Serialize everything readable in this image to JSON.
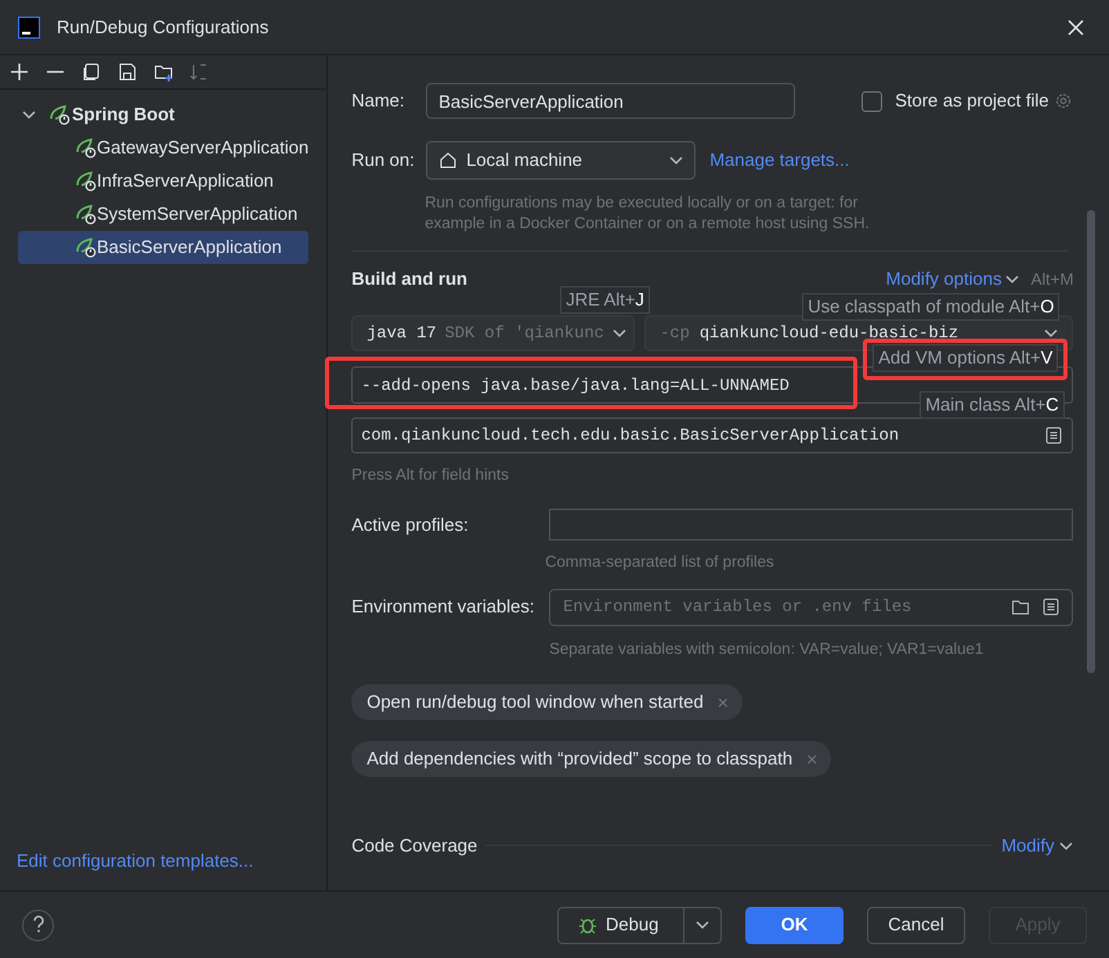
{
  "window": {
    "title": "Run/Debug Configurations"
  },
  "tree": {
    "label": "Spring Boot",
    "expanded": true,
    "children": [
      {
        "label": "GatewayServerApplication",
        "selected": false
      },
      {
        "label": "InfraServerApplication",
        "selected": false
      },
      {
        "label": "SystemServerApplication",
        "selected": false
      },
      {
        "label": "BasicServerApplication",
        "selected": true
      }
    ]
  },
  "templates_link": "Edit configuration templates...",
  "name": {
    "label": "Name:",
    "value": "BasicServerApplication"
  },
  "store_checkbox": {
    "label": "Store as project file",
    "checked": false
  },
  "run_on": {
    "label": "Run on:",
    "value": "Local machine",
    "link": "Manage targets...",
    "hint": "Run configurations may be executed locally or on a target: for example in a Docker Container or on a remote host using SSH."
  },
  "build_and_run": {
    "title": "Build and run",
    "modify_link": "Modify options",
    "modify_shortcut": "Alt+M",
    "jre": {
      "version": "java 17",
      "detail": "SDK of 'qiankunc"
    },
    "classpath": {
      "prefix": "-cp",
      "module": "qiankuncloud-edu-basic-biz"
    },
    "vm_options": "--add-opens java.base/java.lang=ALL-UNNAMED",
    "main_class": "com.qiankuncloud.tech.edu.basic.BasicServerApplication",
    "field_hint": "Press Alt for field hints"
  },
  "active_profiles": {
    "label": "Active profiles:",
    "hint": "Comma-separated list of profiles"
  },
  "environment": {
    "label": "Environment variables:",
    "placeholder": "Environment variables or .env files",
    "hint": "Separate variables with semicolon: VAR=value; VAR1=value1"
  },
  "chips": [
    {
      "label": "Open run/debug tool window when started",
      "close": "×"
    },
    {
      "label": "Add dependencies with “provided” scope to classpath",
      "close": "×"
    }
  ],
  "code_coverage": {
    "title": "Code Coverage",
    "link": "Modify"
  },
  "field_tooltips": [
    {
      "label": "JRE Alt+",
      "key": "J"
    },
    {
      "label": "Use classpath of module Alt+",
      "key": "O"
    },
    {
      "label": "Add VM options Alt+",
      "key": "V"
    },
    {
      "label": "Main class Alt+",
      "key": "C"
    }
  ],
  "buttons": [
    {
      "label": "Debug",
      "kind": "split",
      "disabled": false
    },
    {
      "label": "OK",
      "kind": "primary",
      "disabled": false
    },
    {
      "label": "Cancel",
      "kind": "normal",
      "disabled": false
    },
    {
      "label": "Apply",
      "kind": "normal",
      "disabled": true
    }
  ]
}
